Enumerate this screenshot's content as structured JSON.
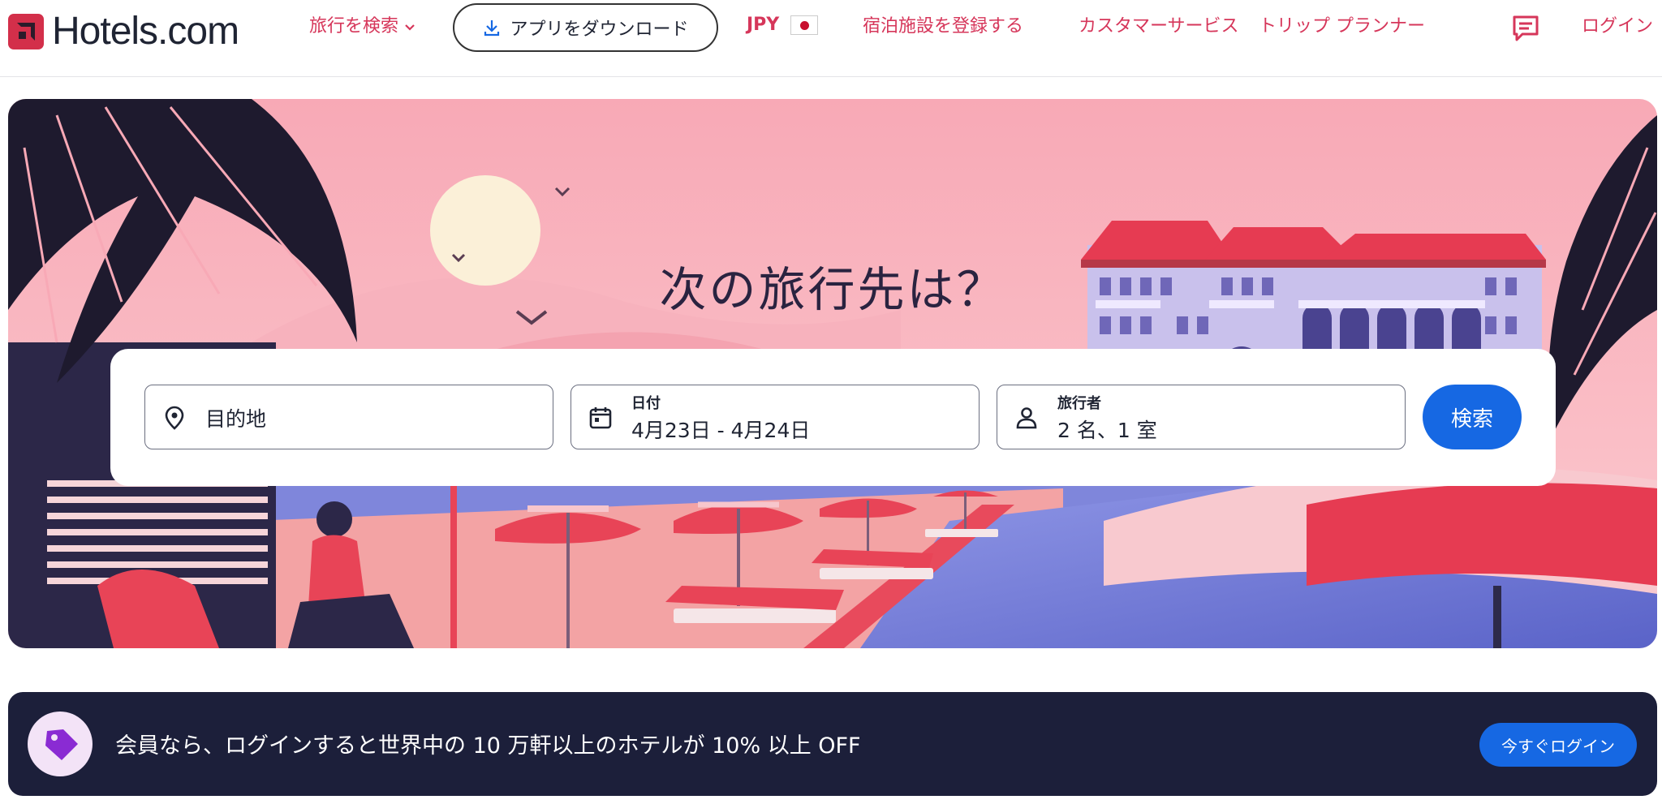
{
  "header": {
    "logo_text": "Hotels.com",
    "nav_search": "旅行を検索",
    "app_download": "アプリをダウンロード",
    "currency": "JPY",
    "register": "宿泊施設を登録する",
    "customer_service": "カスタマーサービス",
    "trip_planner": "トリップ プランナー",
    "login": "ログイン"
  },
  "hero": {
    "title": "次の旅行先は？"
  },
  "search": {
    "destination_placeholder": "目的地",
    "date_label": "日付",
    "date_value": "4月23日 - 4月24日",
    "travelers_label": "旅行者",
    "travelers_value": "2 名、1 室",
    "search_button": "検索"
  },
  "promo": {
    "text": "会員なら、ログインすると世界中の 10 万軒以上のホテルが 10% 以上 OFF",
    "button": "今すぐログイン"
  },
  "colors": {
    "brand_red": "#d6365a",
    "primary_blue": "#1668e3",
    "banner_navy": "#1c1f3a"
  }
}
